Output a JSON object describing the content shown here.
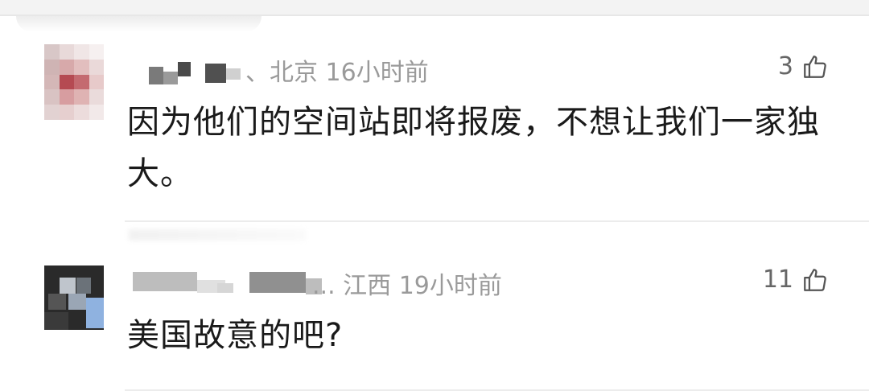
{
  "comments": [
    {
      "location": "、北京",
      "time": "16小时前",
      "likes": "3",
      "text": "因为他们的空间站即将报废，不想让我们一家独大。"
    },
    {
      "location": "... 江西",
      "time": "19小时前",
      "likes": "11",
      "text": "美国故意的吧?"
    }
  ],
  "icons": {
    "like": "thumbs-up-icon"
  },
  "colors": {
    "meta": "#9a9a9a",
    "text": "#1a1a1a",
    "divider": "#ececec"
  }
}
